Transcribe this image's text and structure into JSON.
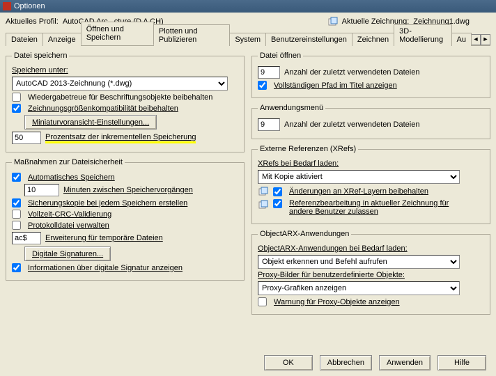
{
  "titlebar": {
    "text": "Optionen"
  },
  "header": {
    "profile_label": "Aktuelles Profil:",
    "profile_value": "AutoCAD Arc...cture (D A CH)",
    "drawing_label": "Aktuelle Zeichnung:",
    "drawing_value": "Zeichnung1.dwg"
  },
  "tabs": {
    "items": [
      "Dateien",
      "Anzeige",
      "Öffnen und Speichern",
      "Plotten und Publizieren",
      "System",
      "Benutzereinstellungen",
      "Zeichnen",
      "3D-Modellierung",
      "Au"
    ],
    "active_index": 2
  },
  "left": {
    "save": {
      "legend": "Datei speichern",
      "save_as_label": "Speichern unter:",
      "save_as_value": "AutoCAD 2013-Zeichnung (*.dwg)",
      "annot_fidelity": "Wiedergabetreue für Beschriftungsobjekte beibehalten",
      "size_compat": "Zeichnungsgrößenkompatibilität beibehalten",
      "thumb_btn": "Miniaturvoransicht-Einstellungen...",
      "incr_value": "50",
      "incr_label": "Prozentsatz der inkrementellen Speicherung"
    },
    "safety": {
      "legend": "Maßnahmen zur Dateisicherheit",
      "autosave": "Automatisches Speichern",
      "autosave_value": "10",
      "autosave_unit": "Minuten zwischen Speichervorgängen",
      "backup": "Sicherungskopie bei jedem Speichern erstellen",
      "crc": "Vollzeit-CRC-Validierung",
      "log": "Protokolldatei verwalten",
      "temp_ext_value": "ac$",
      "temp_ext_label": "Erweiterung für temporäre Dateien",
      "sig_btn": "Digitale Signaturen...",
      "show_sig": "Informationen über digitale Signatur anzeigen"
    }
  },
  "right": {
    "open": {
      "legend": "Datei öffnen",
      "recent_value": "9",
      "recent_label": "Anzahl der zuletzt verwendeten Dateien",
      "fullpath": "Vollständigen Pfad im Titel anzeigen"
    },
    "appmenu": {
      "legend": "Anwendungsmenü",
      "recent_value": "9",
      "recent_label": "Anzahl der zuletzt verwendeten Dateien"
    },
    "xrefs": {
      "legend": "Externe Referenzen (XRefs)",
      "load_label": "XRefs bei Bedarf laden:",
      "load_value": "Mit Kopie aktiviert",
      "retain_layers": "Änderungen an XRef-Layern beibehalten",
      "refedit": "Referenzbearbeitung in aktueller Zeichnung für andere Benutzer zulassen"
    },
    "arx": {
      "legend": "ObjectARX-Anwendungen",
      "load_label": "ObjectARX-Anwendungen bei Bedarf laden:",
      "load_value": "Objekt erkennen und Befehl aufrufen",
      "proxy_label": "Proxy-Bilder für benutzerdefinierte Objekte:",
      "proxy_value": "Proxy-Grafiken anzeigen",
      "proxy_warn": "Warnung für Proxy-Objekte anzeigen"
    }
  },
  "footer": {
    "ok": "OK",
    "cancel": "Abbrechen",
    "apply": "Anwenden",
    "help": "Hilfe"
  }
}
